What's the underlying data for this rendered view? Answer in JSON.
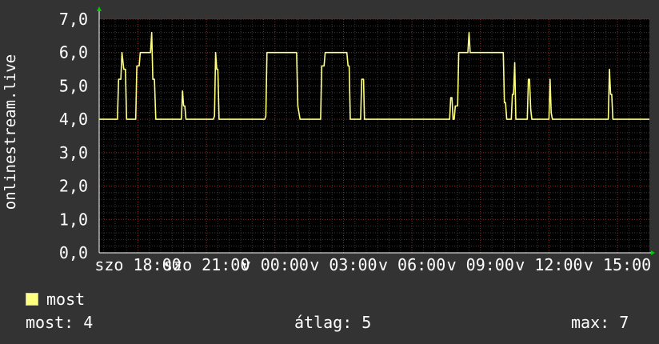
{
  "chart_data": {
    "type": "line",
    "ylabel": "onlinestream.live",
    "ylim": [
      0,
      7
    ],
    "yticks": [
      "0,0",
      "1,0",
      "2,0",
      "3,0",
      "4,0",
      "5,0",
      "6,0",
      "7,0"
    ],
    "xticks": [
      "szo 18:00",
      "szo 21:00",
      "v 00:00",
      "v 03:00",
      "v 06:00",
      "v 09:00",
      "v 12:00",
      "v 15:00"
    ],
    "xlim_hours": [
      16.3,
      40.4
    ],
    "grid": true,
    "series": [
      {
        "name": "most",
        "color": "#ffff80",
        "points": [
          [
            16.3,
            4
          ],
          [
            17.1,
            4
          ],
          [
            17.15,
            5.2
          ],
          [
            17.25,
            5.2
          ],
          [
            17.3,
            6
          ],
          [
            17.38,
            5.5
          ],
          [
            17.45,
            5.5
          ],
          [
            17.5,
            4
          ],
          [
            17.9,
            4
          ],
          [
            17.95,
            5.6
          ],
          [
            18.05,
            5.6
          ],
          [
            18.1,
            6
          ],
          [
            18.55,
            6
          ],
          [
            18.6,
            6.6
          ],
          [
            18.65,
            5.2
          ],
          [
            18.72,
            5.2
          ],
          [
            18.78,
            4
          ],
          [
            19.9,
            4
          ],
          [
            19.95,
            4.85
          ],
          [
            20.0,
            4.4
          ],
          [
            20.05,
            4.4
          ],
          [
            20.1,
            4
          ],
          [
            21.3,
            4
          ],
          [
            21.35,
            4.1
          ],
          [
            21.4,
            6
          ],
          [
            21.45,
            5.5
          ],
          [
            21.5,
            5.5
          ],
          [
            21.55,
            4
          ],
          [
            23.55,
            4
          ],
          [
            23.6,
            4.1
          ],
          [
            23.65,
            6
          ],
          [
            24.95,
            6
          ],
          [
            25.0,
            4.4
          ],
          [
            25.1,
            4
          ],
          [
            26.0,
            4
          ],
          [
            26.05,
            5.6
          ],
          [
            26.15,
            5.6
          ],
          [
            26.2,
            6
          ],
          [
            27.15,
            6
          ],
          [
            27.2,
            5.6
          ],
          [
            27.25,
            5.6
          ],
          [
            27.3,
            4
          ],
          [
            27.75,
            4
          ],
          [
            27.8,
            5.2
          ],
          [
            27.88,
            5.2
          ],
          [
            27.92,
            4
          ],
          [
            31.65,
            4
          ],
          [
            31.7,
            4.65
          ],
          [
            31.75,
            4.65
          ],
          [
            31.8,
            4
          ],
          [
            31.85,
            4
          ],
          [
            31.9,
            4.4
          ],
          [
            32.0,
            4.4
          ],
          [
            32.05,
            6
          ],
          [
            32.45,
            6
          ],
          [
            32.5,
            6.6
          ],
          [
            32.55,
            6
          ],
          [
            34.0,
            6
          ],
          [
            34.05,
            4.5
          ],
          [
            34.1,
            4.5
          ],
          [
            34.15,
            4
          ],
          [
            34.35,
            4
          ],
          [
            34.4,
            4.75
          ],
          [
            34.45,
            4.75
          ],
          [
            34.5,
            5.7
          ],
          [
            34.55,
            4
          ],
          [
            35.05,
            4
          ],
          [
            35.1,
            5.2
          ],
          [
            35.15,
            5.2
          ],
          [
            35.2,
            4.3
          ],
          [
            35.25,
            4
          ],
          [
            36.0,
            4
          ],
          [
            36.05,
            5.2
          ],
          [
            36.1,
            4.2
          ],
          [
            36.15,
            4
          ],
          [
            38.6,
            4
          ],
          [
            38.65,
            5.5
          ],
          [
            38.7,
            4.75
          ],
          [
            38.75,
            4.75
          ],
          [
            38.8,
            4
          ],
          [
            40.4,
            4
          ]
        ]
      }
    ]
  },
  "legend": {
    "label": "most"
  },
  "stats": {
    "current": "most: 4",
    "average": "átlag: 5",
    "max": "max: 7"
  }
}
